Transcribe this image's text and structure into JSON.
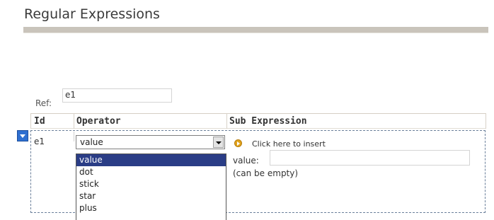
{
  "page": {
    "title": "Regular Expressions"
  },
  "ref": {
    "label": "Ref:",
    "value": "e1"
  },
  "table": {
    "headers": {
      "id": "Id",
      "operator": "Operator",
      "sub_expression": "Sub Expression"
    },
    "row": {
      "id": "e1",
      "operator_selected": "value",
      "insert_link": "Click here to insert",
      "value_label": "value:",
      "value_input": "",
      "value_hint": "(can be empty)"
    }
  },
  "dropdown": {
    "options": [
      "value",
      "dot",
      "stick",
      "star",
      "plus"
    ],
    "highlighted": "value"
  },
  "icons": {
    "collapse": "collapse-triangle-icon",
    "insert": "insert-arrow-icon"
  },
  "colors": {
    "highlight": "#2a3d86",
    "insert_icon": "#e0a21c",
    "collapse_button": "#2e6fd0"
  }
}
